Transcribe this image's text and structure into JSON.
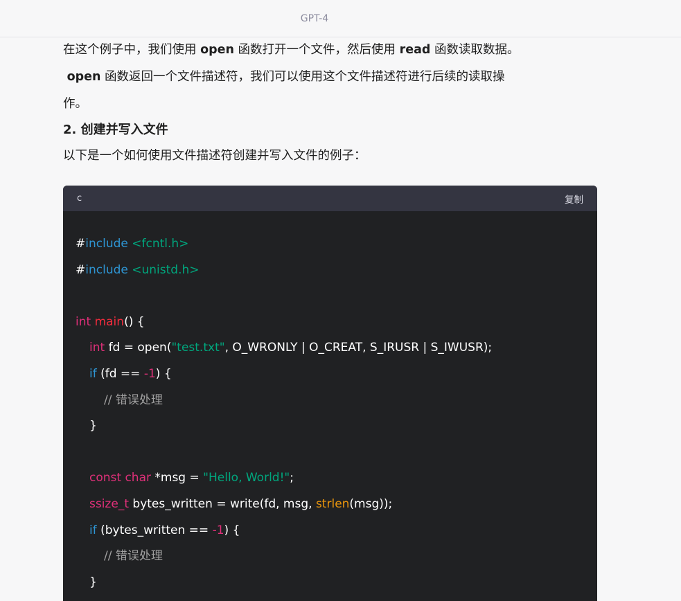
{
  "header": {
    "title": "GPT-4"
  },
  "text": {
    "p1_a": "在这个例子中，我们使用 ",
    "p1_b": "open",
    "p1_c": " 函数打开一个文件，然后使用 ",
    "p1_d": "read",
    "p1_e": " 函数读取数据。",
    "p2_b": "open",
    "p2_c": " 函数返回一个文件描述符，我们可以使用这个文件描述符进行后续的读取操",
    "p3": "作。",
    "heading": "2. 创建并写入文件",
    "p4": "以下是一个如何使用文件描述符创建并写入文件的例子："
  },
  "code": {
    "language": "c",
    "copy_label": "复制",
    "tokens": {
      "hash": "#",
      "include": "include",
      "fcntl": "<fcntl.h>",
      "unistd": "<unistd.h>",
      "int": "int",
      "main": "main",
      "main_rest": "() {",
      "fd_decl": " fd = open(",
      "test_txt": "\"test.txt\"",
      "open_args": ", O_WRONLY | O_CREAT, S_IRUSR | S_IWUSR);",
      "if": "if",
      "if_fd": " (fd == ",
      "neg_one": "-1",
      "if_close": ") {",
      "comment": "// 错误处理",
      "close_brace": "}",
      "const": "const",
      "char": "char",
      "msg_decl": " *msg = ",
      "hello": "\"Hello, World!\"",
      "semi": ";",
      "ssize_t": "ssize_t",
      "bw_decl": " bytes_written = write(fd, msg, ",
      "strlen": "strlen",
      "strlen_rest": "(msg));",
      "if_bw": " (bytes_written == "
    }
  }
}
